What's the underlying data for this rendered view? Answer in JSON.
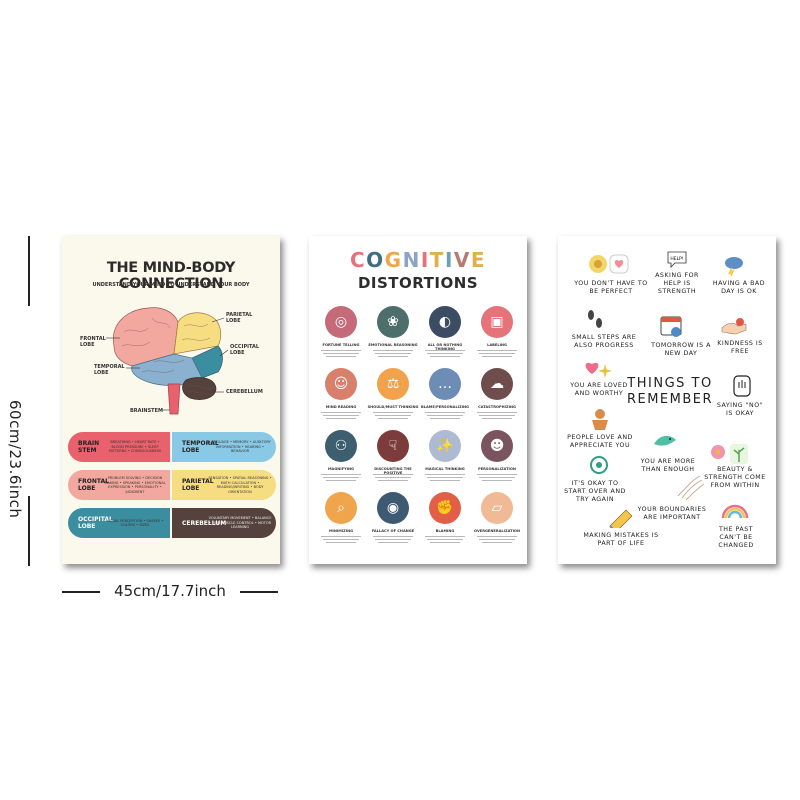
{
  "dimensions": {
    "height": "60cm/23.6inch",
    "width": "45cm/17.7inch"
  },
  "poster1": {
    "title": "THE MIND-BODY CONNECTION",
    "subtitle": "UNDERSTAND YOUR MIND TO UNDERSTAND YOUR BODY",
    "labels": {
      "frontal": "FRONTAL LOBE",
      "parietal": "PARIETAL LOBE",
      "occipital": "OCCIPITAL LOBE",
      "temporal": "TEMPORAL LOBE",
      "cerebellum": "CEREBELLUM",
      "brainstem": "BRAINSTEM"
    },
    "regions": [
      {
        "name": "BRAIN STEM",
        "desc": "BREATHING • HEART RATE • BLOOD PRESSURE • SLEEP PATTERNS • CONSCIOUSNESS",
        "color": "#e8616c"
      },
      {
        "name": "TEMPORAL LOBE",
        "desc": "LANGUAGE • MEMORY • AUDITORY INFORMATION • HEARING • BEHAVIOR",
        "color": "#8ac9e6"
      },
      {
        "name": "FRONTAL LOBE",
        "desc": "PROBLEM SOLVING • DECISION MAKING • SPEAKING • EMOTIONAL EXPRESSION • PERSONALITY • JUDGMENT",
        "color": "#f2a89f"
      },
      {
        "name": "PARIETAL LOBE",
        "desc": "SENSATION • SPATIAL REASONING • MATH CALCULATION • READING/WRITING • BODY ORIENTATION",
        "color": "#f6dd82"
      },
      {
        "name": "OCCIPITAL LOBE",
        "desc": "VISUAL PERCEPTION • SHAPES • COLORS • SIZES",
        "color": "#3a8ea0"
      },
      {
        "name": "CEREBELLUM",
        "desc": "VOLUNTARY MOVEMENT • BALANCE • FINE MUSCLE CONTROL • MOTOR LEARNING",
        "color": "#55423c"
      }
    ]
  },
  "poster2": {
    "title_letters": [
      "C",
      "O",
      "G",
      "N",
      "I",
      "T",
      "I",
      "V",
      "E"
    ],
    "title_colors": [
      "#e7717a",
      "#3f6f7f",
      "#f0a64b",
      "#8aa4c8",
      "#e7717a",
      "#e0b04a",
      "#6aa1b4",
      "#b57b73",
      "#e0b04a"
    ],
    "title2": "DISTORTIONS",
    "items": [
      {
        "label": "FORTUNE TELLING",
        "color": "#c46a78",
        "icon": "crystal-ball-icon"
      },
      {
        "label": "EMOTIONAL REASONING",
        "color": "#4e6e6c",
        "icon": "brain-icon"
      },
      {
        "label": "ALL OR NOTHING THINKING",
        "color": "#3b4c63",
        "icon": "half-circle-icon"
      },
      {
        "label": "LABELING",
        "color": "#e4747a",
        "icon": "label-jar-icon"
      },
      {
        "label": "MIND READING",
        "color": "#d8806c",
        "icon": "person-icon"
      },
      {
        "label": "SHOULD/MUST THINKING",
        "color": "#f2a24a",
        "icon": "scales-icon"
      },
      {
        "label": "BLAME/PERSONALIZING",
        "color": "#6d8db7",
        "icon": "chat-icon"
      },
      {
        "label": "CATASTROPHIZING",
        "color": "#6f4d4d",
        "icon": "storm-icon"
      },
      {
        "label": "MAGNIFYING",
        "color": "#3d5e6e",
        "icon": "people-icon"
      },
      {
        "label": "DISCOUNTING THE POSITIVE",
        "color": "#7d3c3c",
        "icon": "thumbs-down-icon"
      },
      {
        "label": "MAGICAL THINKING",
        "color": "#aebad1",
        "icon": "magic-wand-icon"
      },
      {
        "label": "PERSONALIZATION",
        "color": "#7a5560",
        "icon": "user-icon"
      },
      {
        "label": "MINIMIZING",
        "color": "#f0a44c",
        "icon": "magnifier-icon"
      },
      {
        "label": "FALLACY OF CHANGE",
        "color": "#3d5a72",
        "icon": "user-circle-icon"
      },
      {
        "label": "BLAMING",
        "color": "#e25e47",
        "icon": "fist-icon"
      },
      {
        "label": "OVERGENERALIZATION",
        "color": "#f0ba96",
        "icon": "eraser-icon"
      }
    ]
  },
  "poster3": {
    "title": "THINGS TO REMEMBER",
    "items": [
      "YOU DON'T HAVE TO BE PERFECT",
      "ASKING FOR HELP IS STRENGTH",
      "HAVING A BAD DAY IS OK",
      "SMALL STEPS ARE ALSO PROGRESS",
      "TOMORROW IS A NEW DAY",
      "KINDNESS IS FREE",
      "YOU ARE LOVED AND WORTHY",
      "SAYING \"NO\" IS OKAY",
      "PEOPLE LOVE AND APPRECIATE YOU",
      "YOU ARE MORE THAN ENOUGH",
      "BEAUTY & STRENGTH COME FROM WITHIN",
      "IT'S OKAY TO START OVER AND TRY AGAIN",
      "YOUR BOUNDARIES ARE IMPORTANT",
      "THE PAST CAN'T BE CHANGED",
      "MAKING MISTAKES IS PART OF LIFE"
    ],
    "speech_bubble": "HELP!"
  }
}
